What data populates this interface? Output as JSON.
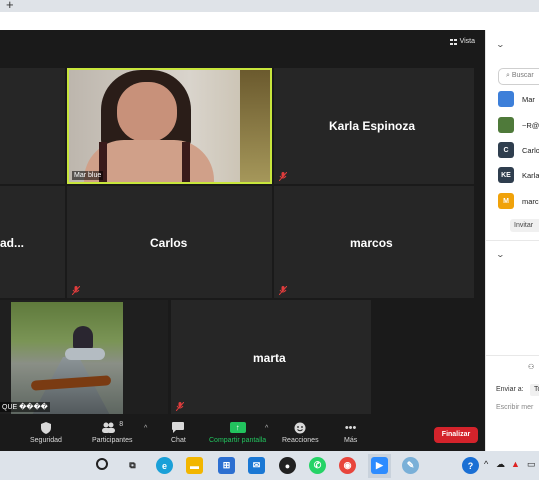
{
  "browser": {
    "new_tab_symbol": "+"
  },
  "meeting": {
    "view_button": "Vista",
    "tiles": [
      {
        "name": "Mar blue",
        "type": "video"
      },
      {
        "name": "Karla Espinoza",
        "type": "name"
      },
      {
        "name": "ad...",
        "type": "name"
      },
      {
        "name": "Carlos",
        "type": "name"
      },
      {
        "name": "marcos",
        "type": "name"
      },
      {
        "name": "QUE ����",
        "type": "photo"
      },
      {
        "name": "marta",
        "type": "name"
      }
    ]
  },
  "toolbar": {
    "security": "Seguridad",
    "participants": "Participantes",
    "participants_count": "8",
    "chat": "Chat",
    "share_screen": "Compartir pantalla",
    "reactions": "Reacciones",
    "more": "Más",
    "end": "Finalizar"
  },
  "panel": {
    "search_placeholder": "Buscar",
    "participants": [
      {
        "name": "Mar",
        "avatar_text": "",
        "color": "#3d7fd9"
      },
      {
        "name": "~R@",
        "avatar_text": "",
        "color": "#4f7a3a"
      },
      {
        "name": "Carlo",
        "avatar_text": "C",
        "color": "#2f3e4e"
      },
      {
        "name": "Karla",
        "avatar_text": "KE",
        "color": "#2f3e4e"
      },
      {
        "name": "marc",
        "avatar_text": "M",
        "color": "#f0a20a"
      }
    ],
    "invite": "Invitar",
    "send_to_label": "Enviar a:",
    "send_to_value": "To",
    "write_message": "Escribir mer"
  },
  "colors": {
    "accent_green": "#22c35e",
    "end_red": "#d4232b",
    "active_speaker_border": "#c8e63c"
  }
}
